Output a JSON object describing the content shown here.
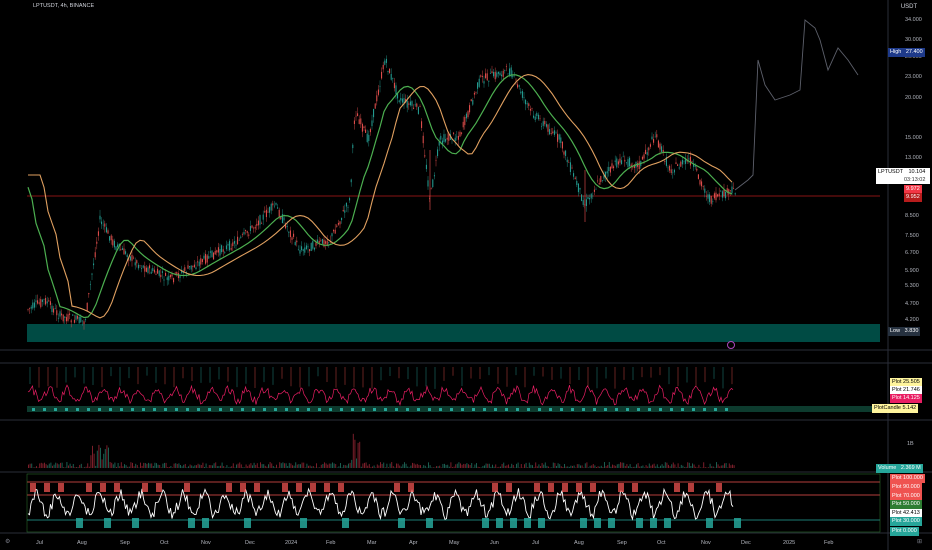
{
  "header": {
    "title": "LPTUSDT, 4h, BINANCE",
    "currency": "USDT"
  },
  "price_axis": [
    "34.000",
    "30.000",
    "26.000",
    "23.000",
    "20.000",
    "15.000",
    "13.000",
    "11.000",
    "9.500",
    "8.500",
    "7.500",
    "6.700",
    "5.900",
    "5.300",
    "4.700",
    "4.200"
  ],
  "x_axis": [
    "Jul",
    "Aug",
    "Sep",
    "Oct",
    "Nov",
    "Dec",
    "2024",
    "Feb",
    "Mar",
    "Apr",
    "May",
    "Jun",
    "Jul",
    "Aug",
    "Sep",
    "Oct",
    "Nov",
    "Dec",
    "2025",
    "Feb"
  ],
  "markers": {
    "high": {
      "label": "High",
      "value": "27.400"
    },
    "low": {
      "label": "Low",
      "value": "3.830"
    },
    "symbol": {
      "label": "LPTUSDT",
      "price": "10.104",
      "countdown": "03:13:02"
    },
    "red1": "9.972",
    "red2": "9.952"
  },
  "osc1": {
    "plots": [
      {
        "label": "Plot",
        "value": "25.505"
      },
      {
        "label": "Plot",
        "value": "21.746"
      },
      {
        "label": "Plot",
        "value": "14.125"
      },
      {
        "label": "PlotCandle",
        "value": "5.142"
      }
    ]
  },
  "volume": {
    "label": "Volume",
    "value": "2.369 M",
    "axis": "1B"
  },
  "osc2": {
    "plots": [
      {
        "label": "Plot",
        "value": "100.000"
      },
      {
        "label": "Plot",
        "value": "90.000"
      },
      {
        "label": "Plot",
        "value": "70.000"
      },
      {
        "label": "Plot",
        "value": "50.000"
      },
      {
        "label": "Plot",
        "value": "42.413"
      },
      {
        "label": "Plot",
        "value": "30.000"
      },
      {
        "label": "Plot",
        "value": "0.000"
      }
    ]
  },
  "colors": {
    "bull": "#26a69a",
    "bear": "#ef5350",
    "ma_green": "#4caf50",
    "ma_orange": "#e0a060",
    "band": "#00897b"
  }
}
